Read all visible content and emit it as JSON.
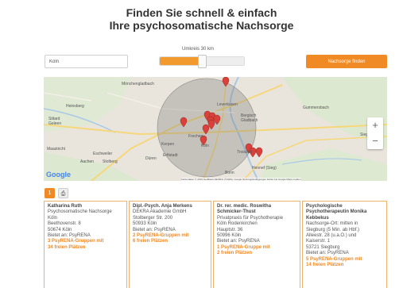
{
  "header": {
    "title_line1": "Finden Sie schnell & einfach",
    "title_line2": "Ihre psychosomatische Nachsorge"
  },
  "search": {
    "location_value": "Köln",
    "radius_label": "Umkreis 30 km",
    "radius_km": 30,
    "slider_fraction": 0.5,
    "find_button": "Nachsorge finden"
  },
  "map": {
    "places": {
      "moenchengladbach": "Mönchengladbach",
      "leverkusen": "Leverkusen",
      "bergisch": "Bergisch",
      "gladbach": "Gladbach",
      "gummersbach": "Gummersbach",
      "heinsberg": "Heinsberg",
      "sittard": "Sittard",
      "geleen": "Geleen",
      "kerpen": "Kerpen",
      "frechen": "Frechen",
      "koeln": "Köln",
      "erftstadt": "Erftstadt",
      "dueren": "Düren",
      "eschweiler": "Eschweiler",
      "aachen": "Aachen",
      "stolberg": "Stolberg",
      "bonn": "Bonn",
      "troisdorf": "Troisdorf",
      "hennef": "Hennef (Sieg)",
      "siegen": "Siegen",
      "maastricht": "Maastricht"
    },
    "zoom_in": "+",
    "zoom_out": "−",
    "google": "Google",
    "credit": "Kartendaten © 2019 GeoBasis-DE/BKG (©2009), Google  Nutzungsbedingungen  Fehler bei Google Maps melden",
    "accent": "#f08a24",
    "marker_color": "#d9413a"
  },
  "tabs": {
    "list_icon": "1",
    "print_icon": "⎙"
  },
  "cards": [
    {
      "name_lines": [
        "Katharina Ruth"
      ],
      "lines": [
        "Psychosomatische Nachsorge",
        "Köln",
        "Beethovenstr. 8",
        "50674 Köln",
        "Bietet an: PsyRENA"
      ],
      "groups_lines": [
        "3 PsyRENA-Gruppen mit",
        "34 freien Plätzen"
      ]
    },
    {
      "name_lines": [
        "Dipl.-Psych. Anja Merkens"
      ],
      "lines": [
        "DEKRA Akademie GmbH",
        "Stolberger Str. 200",
        "50933 Köln",
        "Bietet an: PsyRENA"
      ],
      "groups_lines": [
        "2 PsyRENA-Gruppen mit",
        "6 freien Plätzen"
      ]
    },
    {
      "name_lines": [
        "Dr. rer. medic. Roswitha",
        "Schmicker-Thust"
      ],
      "lines": [
        "Privatpraxis für Psychotherapie",
        "Köln Rodenkirchen",
        "Hauptstr. 36",
        "50996 Köln",
        "Bietet an: PsyRENA"
      ],
      "groups_lines": [
        "1 PsyRENA-Gruppe mit",
        "2 freien Plätzen"
      ]
    },
    {
      "name_lines": [
        "Psychologische",
        "Psychotherapeutin Monika",
        "Kebbekus"
      ],
      "lines": [
        "Nachsorge-Ort: mitten in",
        "Siegburg (5 Min. ab Hbf.)",
        "Alleestr. 28 (u.a.O.) und",
        "Kaiserstr. 1",
        "53721 Siegburg",
        "Bietet an: PsyRENA"
      ],
      "groups_lines": [
        "5 PsyRENA-Gruppen mit",
        "14 freien Plätzen"
      ]
    }
  ]
}
